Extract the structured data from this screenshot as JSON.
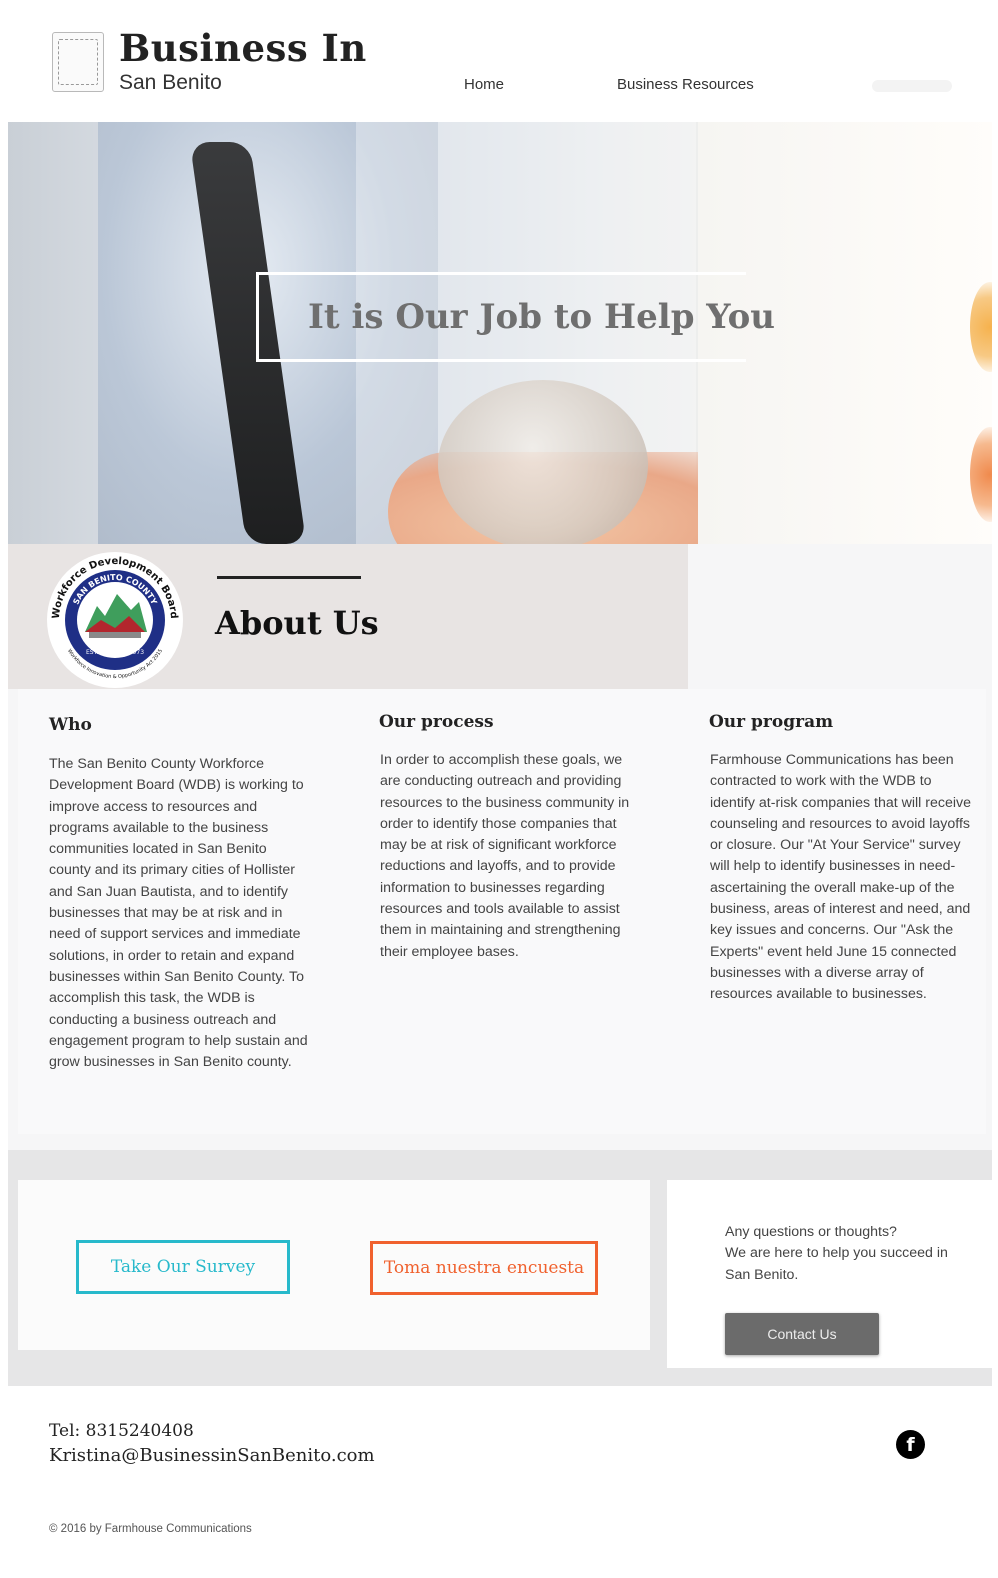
{
  "header": {
    "title": "Business In",
    "subtitle": "San Benito",
    "nav": {
      "home": "Home",
      "resources": "Business Resources"
    }
  },
  "hero": {
    "heading": "It is Our Job to Help You"
  },
  "about": {
    "title": "About Us",
    "seal": {
      "top_text": "Workforce Development Board",
      "inner_text": "SAN BENITO COUNTY",
      "established": "ESTABLISHED 1973",
      "bottom_text": "Workforce Innovation & Opportunity Act 2015"
    },
    "columns": [
      {
        "heading": "Who",
        "text": "The San Benito County Workforce Development Board (WDB) is working to improve access to resources and programs available to the business communities located in San Benito county and its primary cities of Hollister and San Juan Bautista, and to identify businesses that may be at risk and in need of support services and immediate solutions, in order to retain and expand businesses within San Benito County. To accomplish this task, the WDB is conducting a business outreach and engagement program to help sustain and grow businesses in San Benito county."
      },
      {
        "heading": "Our process",
        "text": "In order to accomplish these goals, we are conducting outreach and providing resources to the business community in order to identify those companies that may be at risk of significant workforce reductions and layoffs, and to provide information to businesses regarding resources and tools available to assist them in maintaining and strengthening their employee bases."
      },
      {
        "heading": "Our program",
        "text": "Farmhouse Communications has been contracted to work with the WDB to identify at-risk companies that will receive counseling and resources to avoid layoffs or closure. Our \"At Your Service\" survey will help to identify businesses in need- ascertaining the overall make-up of the business, areas of interest and need, and key issues and concerns. Our \"Ask the Experts\" event held June 15 connected businesses with a diverse array of resources available to businesses."
      }
    ]
  },
  "cta": {
    "survey_en": "Take Our Survey",
    "survey_es": "Toma nuestra encuesta",
    "contact_line1": "Any questions or thoughts?",
    "contact_line2": "We are here to help you succeed in San Benito.",
    "contact_button": "Contact Us",
    "colors": {
      "survey_en": "#27b9cb",
      "survey_es": "#f0612e",
      "contact_button": "#6b6b6b"
    }
  },
  "footer": {
    "tel": "Tel: 8315240408",
    "email": "Kristina@BusinessinSanBenito.com",
    "facebook_icon": "f",
    "copyright": "© 2016 by Farmhouse Communications"
  }
}
